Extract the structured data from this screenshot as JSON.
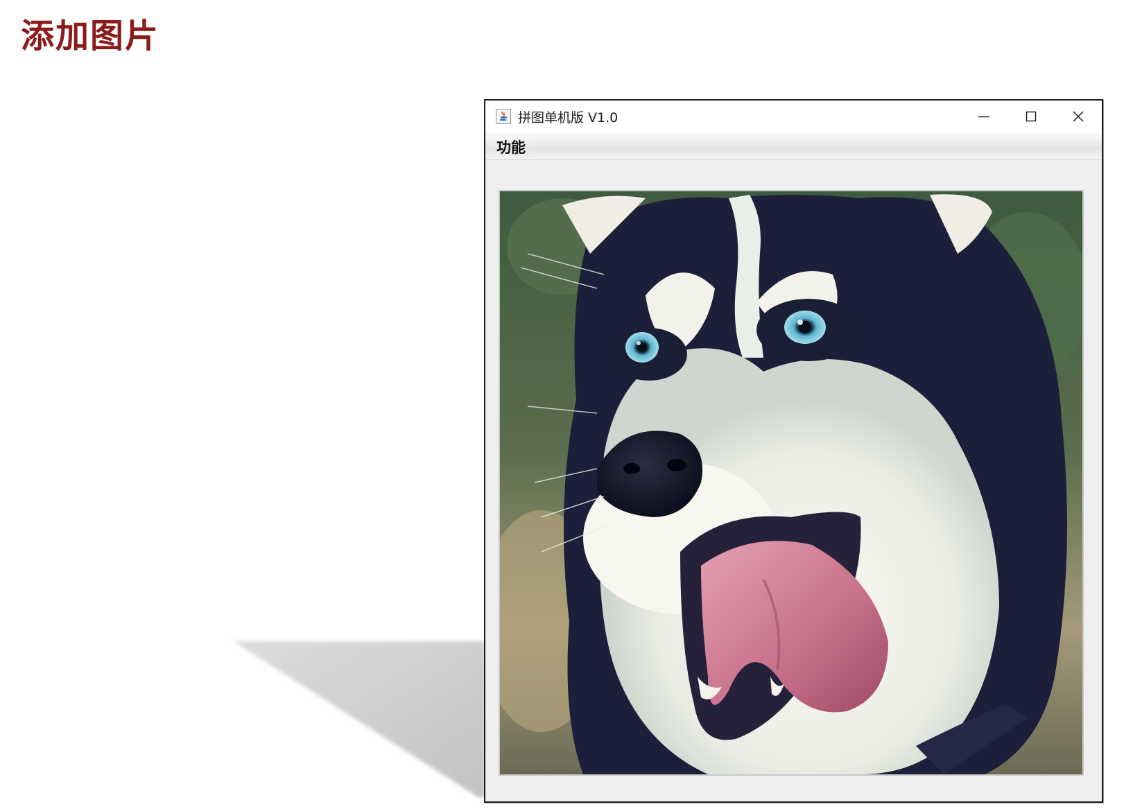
{
  "slide": {
    "title": "添加图片"
  },
  "window": {
    "title": "拼图单机版 V1.0",
    "icon": "java-cup-icon",
    "controls": {
      "minimize_icon": "minimize-icon",
      "maximize_icon": "maximize-icon",
      "close_icon": "close-icon"
    }
  },
  "menubar": {
    "items": [
      {
        "label": "功能"
      }
    ]
  },
  "image": {
    "subject": "husky-dog-photo"
  },
  "colors": {
    "title": "#8b1a1a",
    "window_bg": "#f0f0f0",
    "window_border": "#1c1c1c"
  }
}
